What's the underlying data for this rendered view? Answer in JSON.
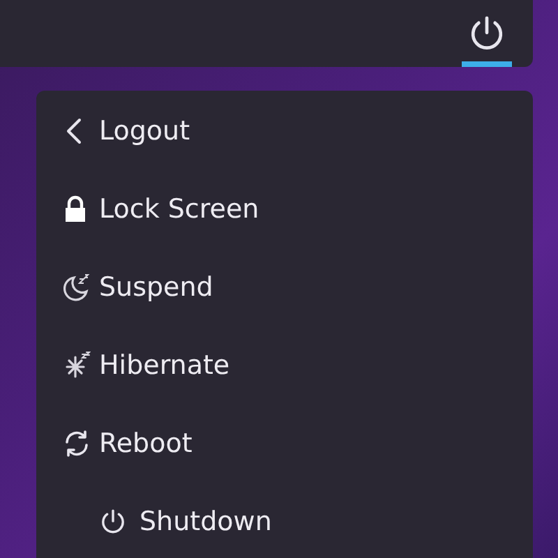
{
  "panel": {
    "power_button": {
      "active": true
    }
  },
  "menu": {
    "items": [
      {
        "kind": "back",
        "label": "Logout"
      },
      {
        "kind": "lock",
        "label": "Lock Screen"
      },
      {
        "kind": "suspend",
        "label": "Suspend"
      },
      {
        "kind": "hibernate",
        "label": "Hibernate"
      },
      {
        "kind": "reboot",
        "label": "Reboot"
      },
      {
        "kind": "shutdown",
        "label": "Shutdown"
      }
    ]
  }
}
